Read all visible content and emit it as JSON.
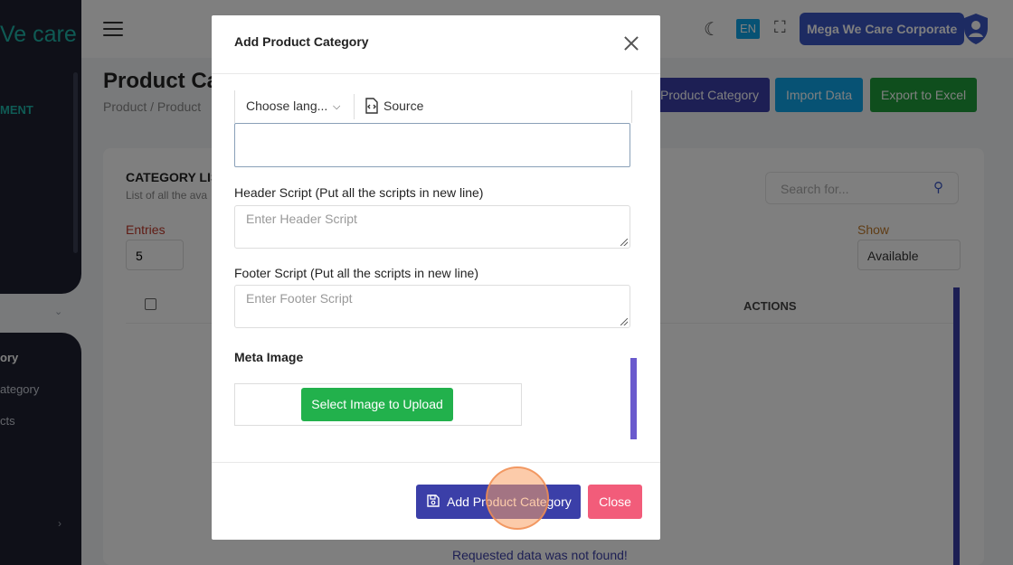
{
  "sidebar": {
    "logo_text": "Ve care",
    "section_label": "MENT",
    "items": [
      {
        "label": "ory"
      },
      {
        "label": "ategory"
      },
      {
        "label": "cts"
      }
    ]
  },
  "topbar": {
    "lang": "EN",
    "company": "Mega We Care Corporate"
  },
  "page": {
    "title": "Product Cat",
    "breadcrumb": "Product  /  Product",
    "buttons": {
      "add": "Product Category",
      "import": "Import Data",
      "export": "Export to Excel"
    },
    "card_title": "CATEGORY LIS",
    "card_subtitle": "List of all the ava",
    "entries_label": "Entries",
    "entries_value": "5",
    "search_placeholder": "Search for...",
    "show_label": "Show",
    "show_value": "Available",
    "actions_header": "ACTIONS",
    "empty_message": "Requested data was not found!"
  },
  "modal": {
    "title": "Add Product Category",
    "editor": {
      "language_select": "Choose lang...",
      "source_label": "Source"
    },
    "header_script": {
      "label": "Header Script (Put all the scripts in new line)",
      "placeholder": "Enter Header Script"
    },
    "footer_script": {
      "label": "Footer Script (Put all the scripts in new line)",
      "placeholder": "Enter Footer Script"
    },
    "meta_image": {
      "label": "Meta Image",
      "upload_button": "Select Image to Upload"
    },
    "submit_button": "Add Product Category",
    "close_button": "Close"
  },
  "colors": {
    "primary": "#3b3fa8",
    "success": "#22b14c",
    "danger": "#f25c7a",
    "info": "#0ea5e9",
    "accent": "#1fb5a8"
  }
}
